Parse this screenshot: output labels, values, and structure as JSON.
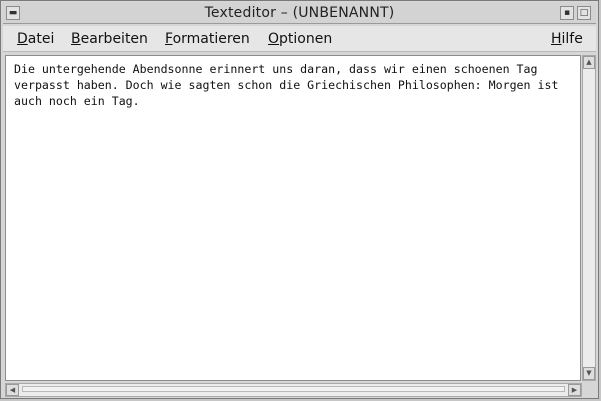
{
  "window": {
    "title": "Texteditor – (UNBENANNT)",
    "controls": {
      "menu_glyph": "▬",
      "minimize_glyph": "▪",
      "maximize_glyph": "□"
    }
  },
  "menubar": {
    "items": [
      {
        "mnemonic": "D",
        "rest": "atei"
      },
      {
        "mnemonic": "B",
        "rest": "earbeiten"
      },
      {
        "mnemonic": "F",
        "rest": "ormatieren"
      },
      {
        "mnemonic": "O",
        "rest": "ptionen"
      },
      {
        "mnemonic": "H",
        "rest": "ilfe"
      }
    ]
  },
  "editor": {
    "content": "Die untergehende Abendsonne erinnert uns daran, dass wir einen schoenen Tag\nverpasst haben. Doch wie sagten schon die Griechischen Philosophen: Morgen ist\nauch noch ein Tag."
  },
  "scrollbars": {
    "up_glyph": "▲",
    "down_glyph": "▼",
    "left_glyph": "◀",
    "right_glyph": "▶"
  }
}
